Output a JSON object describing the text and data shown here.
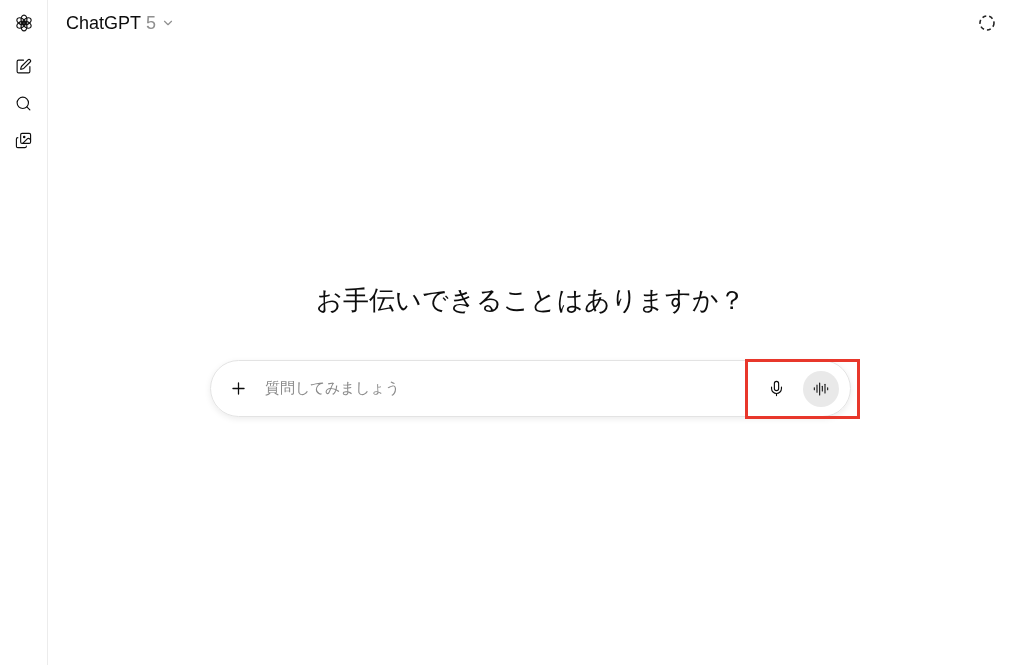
{
  "header": {
    "title": "ChatGPT",
    "version": "5"
  },
  "heading": "お手伝いできることはありますか？",
  "composer": {
    "placeholder": "質問してみましょう",
    "highlight_actions": true
  }
}
